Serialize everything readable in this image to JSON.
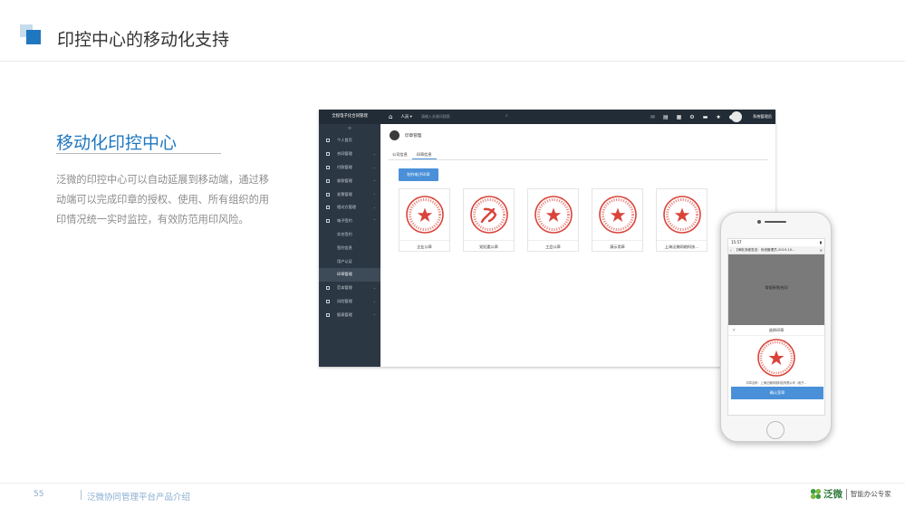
{
  "slide": {
    "title": "印控中心的移动化支持",
    "section_title": "移动化印控中心",
    "description": "泛微的印控中心可以自动延展到移动端，通过移动端可以完成印章的授权、使用、所有组织的用印情况统一实时监控，有效防范用印风险。",
    "page_number": "55",
    "footer_text": "泛微协同管理平台产品介绍",
    "brand_name": "泛微",
    "brand_slogan": "智能办公专家",
    "colors": {
      "accent": "#1f77c0",
      "sidebar": "#2b3743",
      "button": "#4a90d9",
      "seal_red": "#d9443a"
    }
  },
  "app": {
    "logo": "全程电子化合同管理",
    "collapse_icon": "≡",
    "sidebar": [
      {
        "label": "个人首页",
        "icon": "home-icon",
        "chevron": ""
      },
      {
        "label": "合同管理",
        "icon": "contract-icon",
        "chevron": "⌄"
      },
      {
        "label": "付款管理",
        "icon": "payment-icon",
        "chevron": "⌄"
      },
      {
        "label": "收款管理",
        "icon": "receipt-icon",
        "chevron": "⌄"
      },
      {
        "label": "发票管理",
        "icon": "invoice-icon",
        "chevron": "⌄"
      },
      {
        "label": "相对方管理",
        "icon": "counterparty-icon",
        "chevron": "⌄"
      },
      {
        "label": "电子签约",
        "icon": "esign-icon",
        "chevron": "⌃"
      },
      {
        "label": "实名签约",
        "sub": true
      },
      {
        "label": "签约信息",
        "sub": true
      },
      {
        "label": "用户认证",
        "sub": true
      },
      {
        "label": "印章管理",
        "sub": true,
        "active": true
      },
      {
        "label": "范本管理",
        "icon": "template-icon",
        "chevron": "⌄"
      },
      {
        "label": "风险管理",
        "icon": "risk-icon",
        "chevron": "⌄"
      },
      {
        "label": "报表管理",
        "icon": "report-icon",
        "chevron": "⌄"
      }
    ],
    "topbar": {
      "dropdown": "人员 ▾",
      "search_placeholder": "请输入关键词搜索",
      "user_name": "系统管理员"
    },
    "breadcrumb": "印章管理",
    "tabs": [
      {
        "label": "公司信息",
        "active": false
      },
      {
        "label": "印章信息",
        "active": true
      }
    ],
    "make_button": "制作电子印章",
    "seals": [
      {
        "label": "企业公章",
        "type": "round"
      },
      {
        "label": "党纪委公章",
        "type": "party"
      },
      {
        "label": "工会公章",
        "type": "round"
      },
      {
        "label": "演示用章",
        "type": "round"
      },
      {
        "label": "上海泛微网络科技...",
        "type": "round"
      }
    ]
  },
  "phone": {
    "time": "15:57",
    "battery": "▮",
    "nav_title": "【审批流程发送：系统管理员-2019-10...",
    "doc_title": "常规采购合同",
    "sheet_title": "选择印章",
    "seal_info": "印章名称：上海泛微网络科技有限公司（电子...",
    "confirm_button": "确认签章"
  }
}
